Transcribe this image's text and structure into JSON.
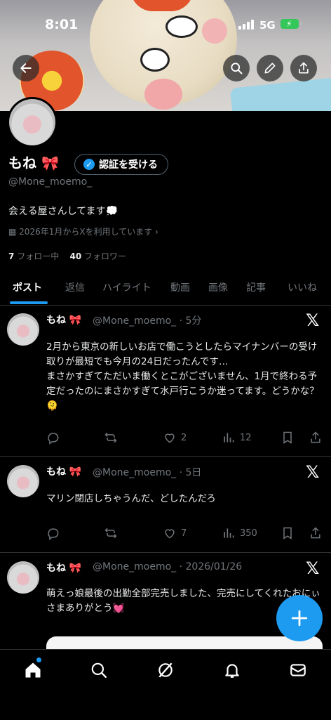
{
  "status_bar": {
    "time": "8:01",
    "network": "5G"
  },
  "profile": {
    "display_name": "もね 🎀",
    "verify_label": "認証を受ける",
    "handle": "@Mone_moemo_",
    "bio": "会える屋さんしてます💭",
    "joined": "2026年1月からXを利用しています",
    "following_count": "7",
    "following_label": "フォロー中",
    "followers_count": "40",
    "followers_label": "フォロワー"
  },
  "tabs": [
    "ポスト",
    "返信",
    "ハイライト",
    "動画",
    "画像",
    "記事",
    "いいね"
  ],
  "posts": [
    {
      "name": "もね 🎀",
      "handle": "@Mone_moemo_",
      "time": "· 5分",
      "text": "2月から東京の新しいお店で働こうとしたらマイナンバーの受け取りが最短でも今月の24日だったんです…\nまさかすぎてただいま働くとこがございません、1月で終わる予定だったのにまさかすぎて水戸行こうか迷ってます。どうかな？🫠",
      "likes": "2",
      "views": "12"
    },
    {
      "name": "もね 🎀",
      "handle": "@Mone_moemo_",
      "time": "· 5日",
      "text": "マリン閉店しちゃうんだ、どしたんだろ",
      "likes": "7",
      "views": "350"
    },
    {
      "name": "もね 🎀",
      "handle": "@Mone_moemo_",
      "time": "· 2026/01/26",
      "text": "萌えっ娘最後の出勤全部完売しました、完売にしてくれたおにぃさまありがとう💓"
    }
  ],
  "icons": {
    "back": "arrow-left-icon",
    "search": "search-icon",
    "edit": "pencil-icon",
    "share": "share-icon",
    "x": "x-logo-icon",
    "compose": "plus-icon"
  },
  "colors": {
    "accent": "#1d9bf0",
    "background": "#000000",
    "muted": "#71767b"
  }
}
